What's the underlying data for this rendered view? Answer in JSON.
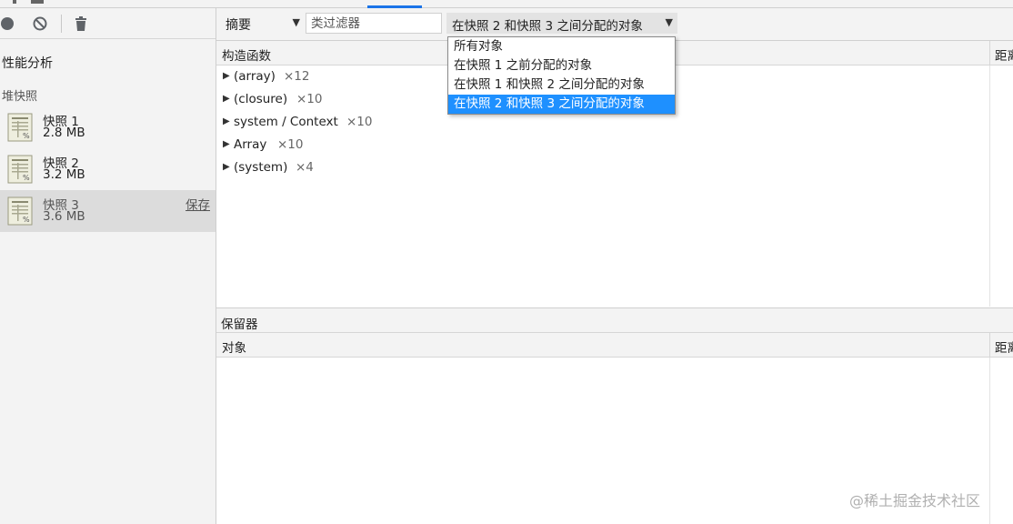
{
  "sidebar": {
    "profiles_title": "性能分析",
    "heap_snapshots_heading": "堆快照",
    "snapshots": [
      {
        "name": "快照 1",
        "size": "2.8 MB"
      },
      {
        "name": "快照 2",
        "size": "3.2 MB"
      },
      {
        "name": "快照 3",
        "size": "3.6 MB",
        "action": "保存"
      }
    ],
    "toolbar_icons": [
      "record-icon",
      "clear-icon",
      "delete-icon"
    ]
  },
  "toolbar": {
    "view_mode": "摘要",
    "filter_placeholder": "类过滤器",
    "range_selected": "在快照 2 和快照 3 之间分配的对象"
  },
  "dropdown": {
    "options": [
      "所有对象",
      "在快照 1 之前分配的对象",
      "在快照 1 和快照 2 之间分配的对象",
      "在快照 2 和快照 3 之间分配的对象"
    ],
    "selected_index": 3
  },
  "constructor_grid": {
    "columns": {
      "constructor": "构造函数",
      "distance": "距离"
    },
    "rows": [
      {
        "name": "(array)",
        "count": "×12"
      },
      {
        "name": "(closure)",
        "count": "×10"
      },
      {
        "name": "system / Context",
        "count": "×10"
      },
      {
        "name": "Array",
        "count": "×10"
      },
      {
        "name": "(system)",
        "count": "×4"
      }
    ]
  },
  "retainers": {
    "title": "保留器",
    "columns": {
      "object": "对象",
      "distance": "距离"
    }
  },
  "watermark": "@稀土掘金技术社区",
  "colors": {
    "accent": "#1a73e8",
    "dropdown_selected": "#1e90ff",
    "panel_bg": "#f3f3f3"
  }
}
